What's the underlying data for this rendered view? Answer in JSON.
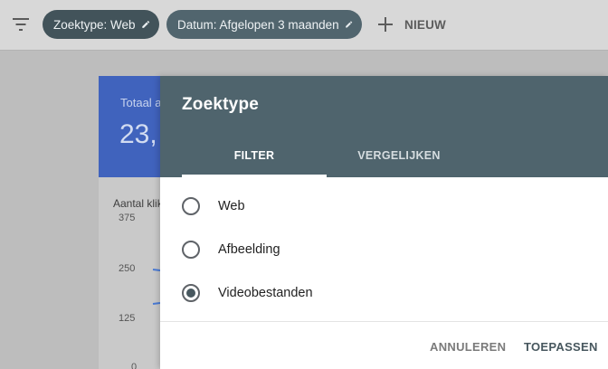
{
  "toolbar": {
    "filter_icon": "filter-list-icon",
    "chips": [
      {
        "label": "Zoektype: Web",
        "icon": "edit-pencil-icon"
      },
      {
        "label": "Datum: Afgelopen 3 maanden",
        "icon": "edit-pencil-icon"
      }
    ],
    "new_button": {
      "label": "NIEUW",
      "icon": "plus-icon"
    }
  },
  "summary_card": {
    "label": "Totaal a",
    "value": "23,",
    "color": "#4063bd"
  },
  "chart": {
    "metric_label": "Aantal klik",
    "y_ticks": [
      "375",
      "250",
      "125",
      "0"
    ],
    "line_color": "#4a7bd6"
  },
  "dialog": {
    "title": "Zoektype",
    "header_color": "#4f646d",
    "tabs": [
      {
        "label": "FILTER",
        "active": true
      },
      {
        "label": "VERGELIJKEN",
        "active": false
      }
    ],
    "options": [
      {
        "label": "Web",
        "selected": false
      },
      {
        "label": "Afbeelding",
        "selected": false
      },
      {
        "label": "Videobestanden",
        "selected": true
      }
    ],
    "actions": {
      "cancel": "ANNULEREN",
      "apply": "TOEPASSEN"
    }
  }
}
